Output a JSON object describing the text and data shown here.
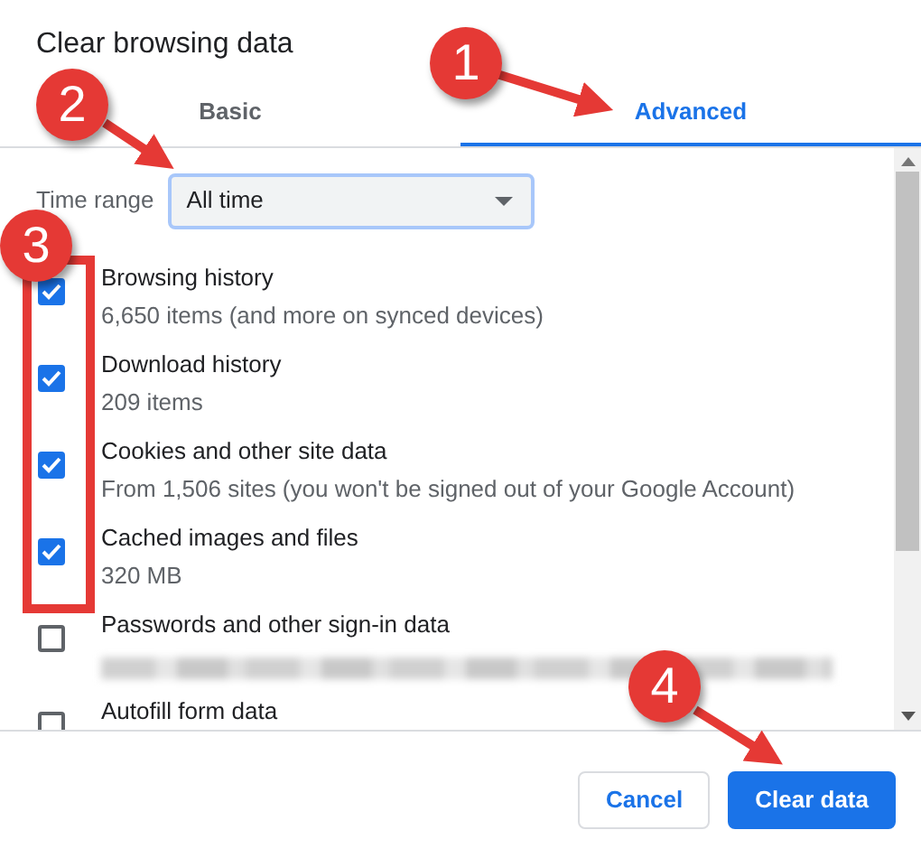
{
  "dialog": {
    "title": "Clear browsing data"
  },
  "tabs": [
    {
      "label": "Basic",
      "selected": false
    },
    {
      "label": "Advanced",
      "selected": true
    }
  ],
  "time_range": {
    "label": "Time range",
    "value": "All time"
  },
  "items": [
    {
      "label": "Browsing history",
      "detail": "6,650 items (and more on synced devices)",
      "checked": true,
      "redacted": false
    },
    {
      "label": "Download history",
      "detail": "209 items",
      "checked": true,
      "redacted": false
    },
    {
      "label": "Cookies and other site data",
      "detail": "From 1,506 sites (you won't be signed out of your Google Account)",
      "checked": true,
      "redacted": false
    },
    {
      "label": "Cached images and files",
      "detail": "320 MB",
      "checked": true,
      "redacted": false
    },
    {
      "label": "Passwords and other sign-in data",
      "checked": false,
      "redacted": true
    },
    {
      "label": "Autofill form data",
      "checked": false,
      "redacted": false
    }
  ],
  "buttons": [
    {
      "label": "Cancel",
      "kind": "secondary"
    },
    {
      "label": "Clear data",
      "kind": "primary"
    }
  ],
  "annotations": [
    {
      "label": "1"
    },
    {
      "label": "2"
    },
    {
      "label": "3"
    },
    {
      "label": "4"
    }
  ]
}
